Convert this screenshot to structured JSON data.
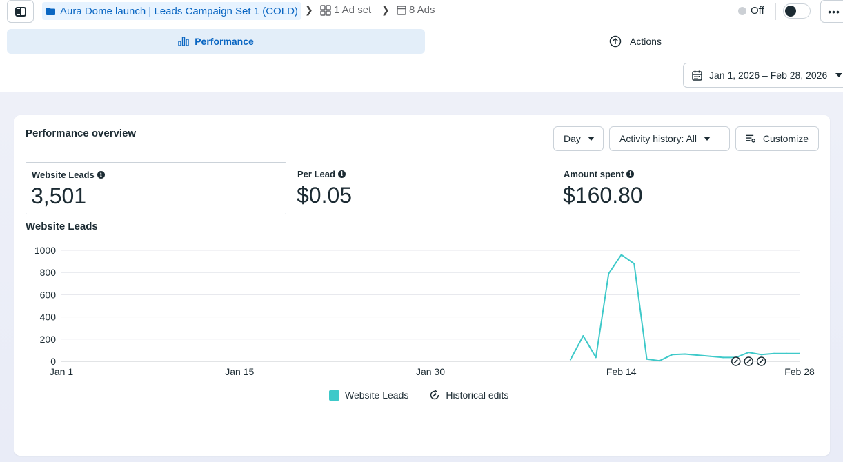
{
  "breadcrumb": {
    "campaign": "Aura Dome launch | Leads Campaign Set 1 (COLD)",
    "ad_set": "1 Ad set",
    "ads": "8 Ads"
  },
  "status": {
    "label": "Off",
    "enabled": false
  },
  "tabs": {
    "performance": "Performance",
    "actions": "Actions"
  },
  "date_range": "Jan 1, 2026 – Feb 28, 2026",
  "overview": {
    "title": "Performance overview",
    "granularity": "Day",
    "activity_history": "Activity history: All",
    "customize": "Customize"
  },
  "metrics": [
    {
      "label": "Website Leads",
      "value": "3,501"
    },
    {
      "label": "Per Lead",
      "value": "$0.05"
    },
    {
      "label": "Amount spent",
      "value": "$160.80"
    }
  ],
  "colors": {
    "series": "#3ec9c9",
    "accent": "#0a66c2"
  },
  "chart_data": {
    "type": "line",
    "title": "Website Leads",
    "ylim": [
      0,
      1000
    ],
    "yticks": [
      0,
      200,
      400,
      600,
      800,
      1000
    ],
    "xlim": [
      "2026-01-01",
      "2026-02-28"
    ],
    "xtick_labels": [
      {
        "date": "2026-01-01",
        "label": "Jan 1"
      },
      {
        "date": "2026-01-15",
        "label": "Jan 15"
      },
      {
        "date": "2026-01-30",
        "label": "Jan 30"
      },
      {
        "date": "2026-02-14",
        "label": "Feb 14"
      },
      {
        "date": "2026-02-28",
        "label": "Feb 28"
      }
    ],
    "grid": true,
    "series": [
      {
        "name": "Website Leads",
        "points": [
          [
            "2026-02-10",
            15
          ],
          [
            "2026-02-11",
            230
          ],
          [
            "2026-02-12",
            35
          ],
          [
            "2026-02-13",
            790
          ],
          [
            "2026-02-14",
            960
          ],
          [
            "2026-02-15",
            880
          ],
          [
            "2026-02-16",
            20
          ],
          [
            "2026-02-17",
            5
          ],
          [
            "2026-02-18",
            60
          ],
          [
            "2026-02-19",
            65
          ],
          [
            "2026-02-20",
            55
          ],
          [
            "2026-02-21",
            45
          ],
          [
            "2026-02-22",
            35
          ],
          [
            "2026-02-23",
            35
          ],
          [
            "2026-02-24",
            80
          ],
          [
            "2026-02-25",
            60
          ],
          [
            "2026-02-26",
            70
          ],
          [
            "2026-02-27",
            70
          ],
          [
            "2026-02-28",
            70
          ]
        ]
      }
    ],
    "historical_edits": [
      "2026-02-23",
      "2026-02-24",
      "2026-02-25"
    ],
    "legend": [
      "Website Leads",
      "Historical edits"
    ],
    "legend_position": "bottom"
  }
}
